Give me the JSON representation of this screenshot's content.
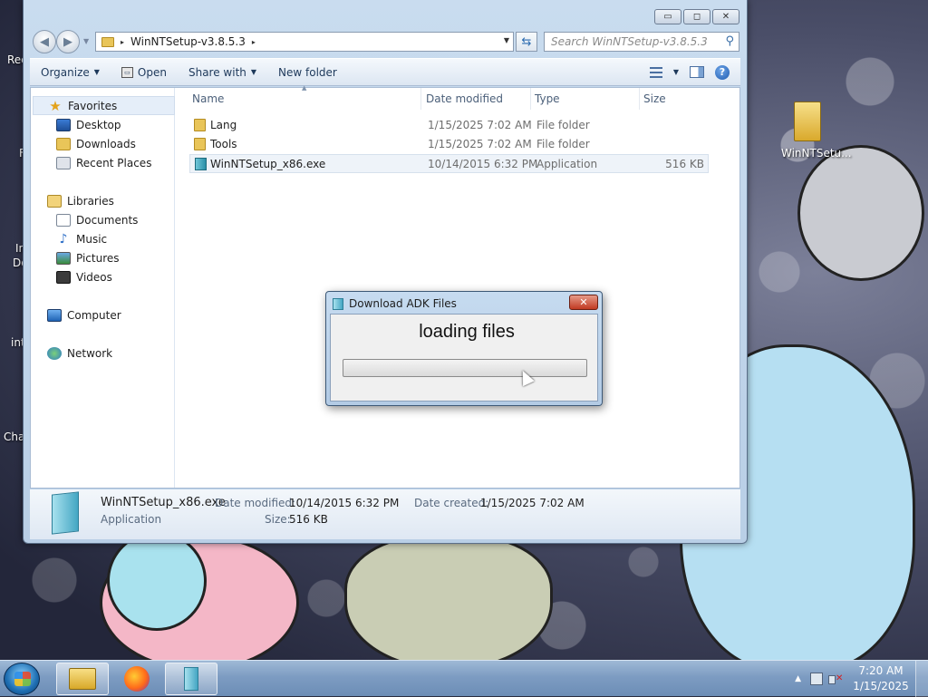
{
  "desktop": {
    "left_labels": [
      "Rec",
      "F",
      "In",
      "Do",
      "int",
      "Cha"
    ],
    "right_icon_label": "WinNTSetu..."
  },
  "explorer": {
    "caption_buttons": {
      "minimize": "▭",
      "restore": "◻",
      "close": "✕"
    },
    "address": {
      "segment": "WinNTSetup-v3.8.5.3",
      "arrow": "▸"
    },
    "search": {
      "placeholder": "Search WinNTSetup-v3.8.5.3"
    },
    "toolbar": {
      "organize": "Organize",
      "open": "Open",
      "share_with": "Share with",
      "new_folder": "New folder"
    },
    "nav_pane": {
      "favorites": {
        "label": "Favorites",
        "items": [
          "Desktop",
          "Downloads",
          "Recent Places"
        ]
      },
      "libraries": {
        "label": "Libraries",
        "items": [
          "Documents",
          "Music",
          "Pictures",
          "Videos"
        ]
      },
      "computer": "Computer",
      "network": "Network"
    },
    "columns": {
      "name": "Name",
      "date_modified": "Date modified",
      "type": "Type",
      "size": "Size"
    },
    "files": [
      {
        "name": "Lang",
        "date": "1/15/2025 7:02 AM",
        "type": "File folder",
        "size": "",
        "icon": "folder-icon"
      },
      {
        "name": "Tools",
        "date": "1/15/2025 7:02 AM",
        "type": "File folder",
        "size": "",
        "icon": "folder-icon"
      },
      {
        "name": "WinNTSetup_x86.exe",
        "date": "10/14/2015 6:32 PM",
        "type": "Application",
        "size": "516 KB",
        "icon": "application-icon"
      }
    ],
    "details": {
      "file_name": "WinNTSetup_x86.exe",
      "file_type": "Application",
      "date_modified_label": "Date modified:",
      "date_modified": "10/14/2015 6:32 PM",
      "date_created_label": "Date created:",
      "date_created": "1/15/2025 7:02 AM",
      "size_label": "Size:",
      "size": "516 KB"
    }
  },
  "dialog": {
    "title": "Download ADK Files",
    "close": "✕",
    "message": "loading files",
    "progress_fraction": 0
  },
  "taskbar": {
    "tray_arrow": "▲",
    "volume_mark": "✕",
    "time": "7:20 AM",
    "date": "1/15/2025"
  }
}
